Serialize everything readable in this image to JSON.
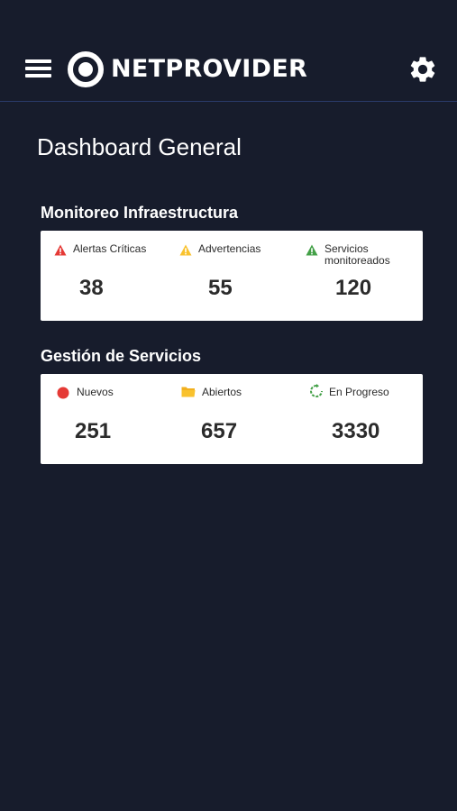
{
  "header": {
    "brand": "NETPROVIDER",
    "menu_icon": "hamburger-menu-icon",
    "logo_icon": "target-logo-icon",
    "settings_icon": "gear-icon"
  },
  "page": {
    "title": "Dashboard General"
  },
  "infra": {
    "title": "Monitoreo Infraestructura",
    "stats": [
      {
        "label": "Alertas Críticas",
        "value": "38",
        "icon": "warning-triangle-icon",
        "color": "#e53935"
      },
      {
        "label": "Advertencias",
        "value": "55",
        "icon": "warning-triangle-icon",
        "color": "#f9c22e"
      },
      {
        "label_line1": "Servicios",
        "label_line2": "monitoreados",
        "value": "120",
        "icon": "warning-triangle-icon",
        "color": "#43a047"
      }
    ]
  },
  "services": {
    "title": "Gestión de Servicios",
    "stats": [
      {
        "label": "Nuevos",
        "value": "251",
        "icon": "circle-icon",
        "color": "#e53935"
      },
      {
        "label": "Abiertos",
        "value": "657",
        "icon": "folder-open-icon",
        "color": "#f9c22e"
      },
      {
        "label": "En Progreso",
        "value": "3330",
        "icon": "refresh-icon",
        "color": "#43a047"
      }
    ]
  },
  "colors": {
    "background": "#171c2c",
    "card": "#ffffff",
    "divider": "#2a3a6a"
  }
}
